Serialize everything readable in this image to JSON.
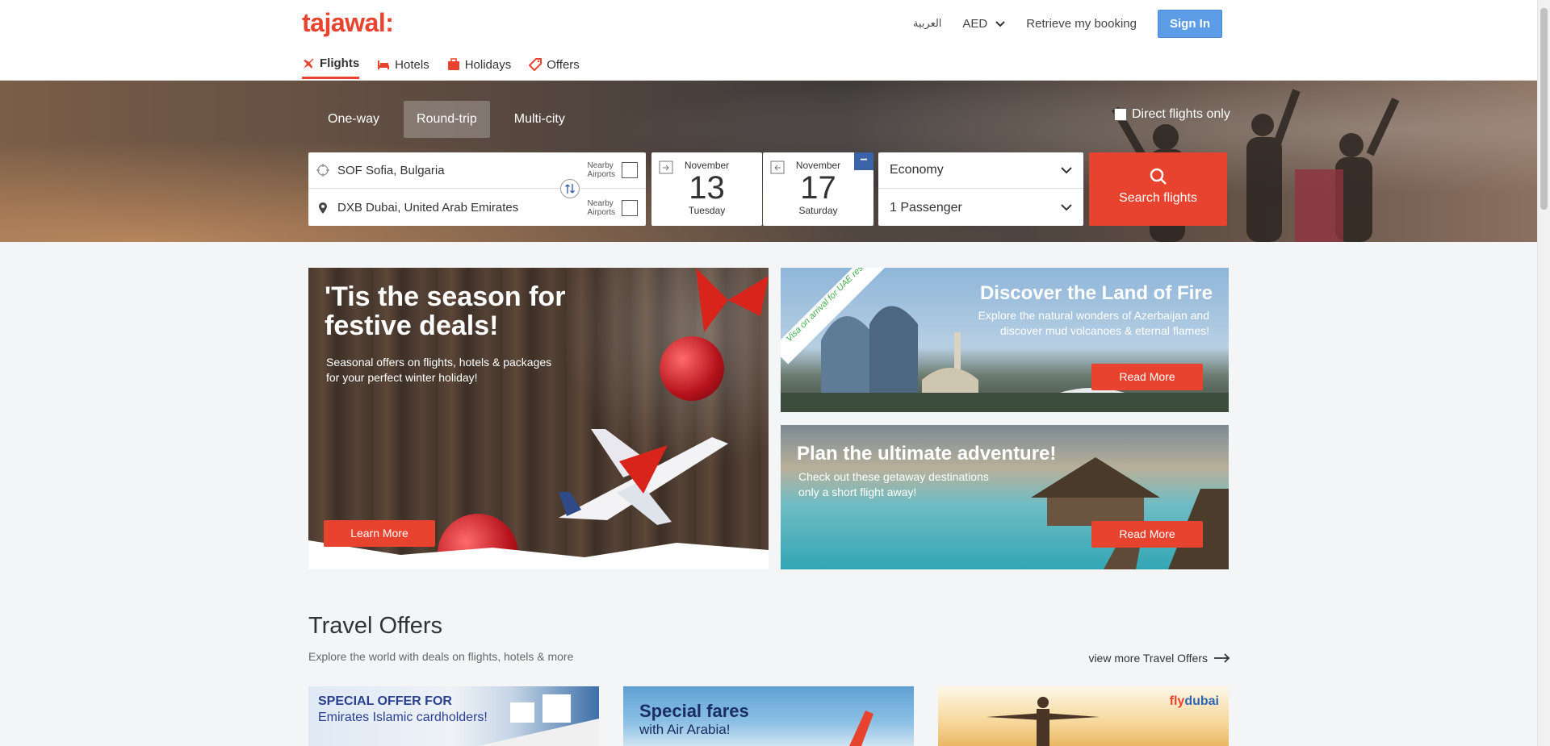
{
  "header": {
    "logo": "tajawal:",
    "arabic": "العربية",
    "currency": "AED",
    "retrieve": "Retrieve my booking",
    "signin": "Sign In",
    "nav": [
      {
        "label": "Flights"
      },
      {
        "label": "Hotels"
      },
      {
        "label": "Holidays"
      },
      {
        "label": "Offers"
      }
    ]
  },
  "search": {
    "trip_types": [
      "One-way",
      "Round-trip",
      "Multi-city"
    ],
    "direct_only": "Direct flights only",
    "from": "SOF Sofia, Bulgaria",
    "to": "DXB Dubai, United Arab Emirates",
    "nearby": "Nearby\nAirports",
    "depart": {
      "month": "November",
      "day": "13",
      "dow": "Tuesday"
    },
    "return": {
      "month": "November",
      "day": "17",
      "dow": "Saturday"
    },
    "cabin": "Economy",
    "passengers": "1 Passenger",
    "button": "Search flights",
    "colors": {
      "accent": "#e8432f",
      "signin": "#5d9ce6"
    }
  },
  "promos": {
    "festive": {
      "title": "'Tis the season for festive deals!",
      "subtitle": "Seasonal offers on flights, hotels & packages for your perfect winter holiday!",
      "button": "Learn More"
    },
    "fire": {
      "ribbon": "Visa on arrival for UAE residents",
      "title": "Discover the Land of Fire",
      "subtitle": "Explore the natural wonders of Azerbaijan and discover mud volcanoes & eternal flames!",
      "button": "Read More"
    },
    "adventure": {
      "title": "Plan the ultimate adventure!",
      "subtitle": "Check out these getaway destinations only a short flight away!",
      "button": "Read More"
    }
  },
  "offers": {
    "title": "Travel Offers",
    "subtitle": "Explore the world with deals on flights, hotels & more",
    "more": "view more Travel Offers",
    "cards": [
      {
        "title": "SPECIAL OFFER FOR",
        "subtitle": "Emirates Islamic cardholders!"
      },
      {
        "title": "Special fares",
        "subtitle": "with Air Arabia!"
      },
      {
        "brand_a": "fly",
        "brand_b": "dubai"
      }
    ]
  }
}
